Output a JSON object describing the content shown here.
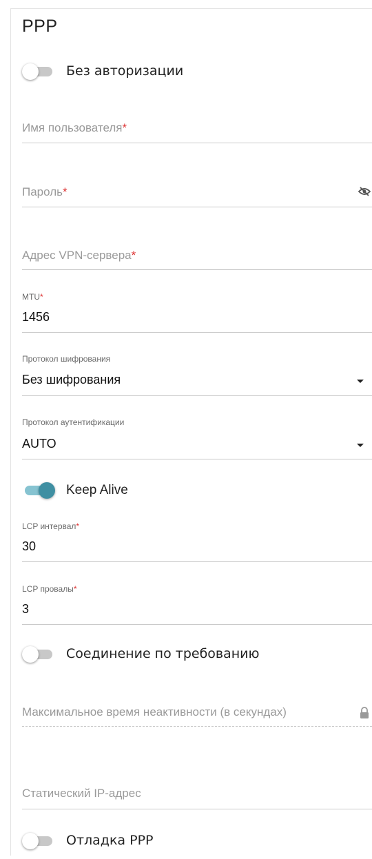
{
  "section_title": "PPP",
  "toggles": {
    "no_auth": {
      "label": "Без авторизации",
      "on": false
    },
    "keep_alive": {
      "label": "Keep Alive",
      "on": true
    },
    "on_demand": {
      "label": "Соединение по требованию",
      "on": false
    },
    "debug_ppp": {
      "label": "Отладка PPP",
      "on": false
    }
  },
  "fields": {
    "username": {
      "placeholder": "Имя пользователя",
      "required_mark": "*"
    },
    "password": {
      "placeholder": "Пароль",
      "required_mark": "*",
      "icon": "eye-off-icon"
    },
    "vpn_server": {
      "placeholder": "Адрес VPN-сервера",
      "required_mark": "*"
    },
    "mtu": {
      "label": "MTU",
      "required_mark": "*",
      "value": "1456"
    },
    "encryption": {
      "label": "Протокол шифрования",
      "value": "Без шифрования"
    },
    "auth_protocol": {
      "label": "Протокол аутентификации",
      "value": "AUTO"
    },
    "lcp_interval": {
      "label": "LCP интервал",
      "required_mark": "*",
      "value": "30"
    },
    "lcp_failures": {
      "label": "LCP провалы",
      "required_mark": "*",
      "value": "3"
    },
    "max_idle": {
      "placeholder": "Максимальное время неактивности (в секундах)",
      "icon": "lock-icon"
    },
    "static_ip": {
      "placeholder": "Статический IP-адрес"
    }
  },
  "colors": {
    "toggle_on_knob": "#3f8fa2",
    "toggle_on_track": "#86c3d1",
    "toggle_off_track": "#c8c8c8",
    "required": "#dd3333"
  }
}
